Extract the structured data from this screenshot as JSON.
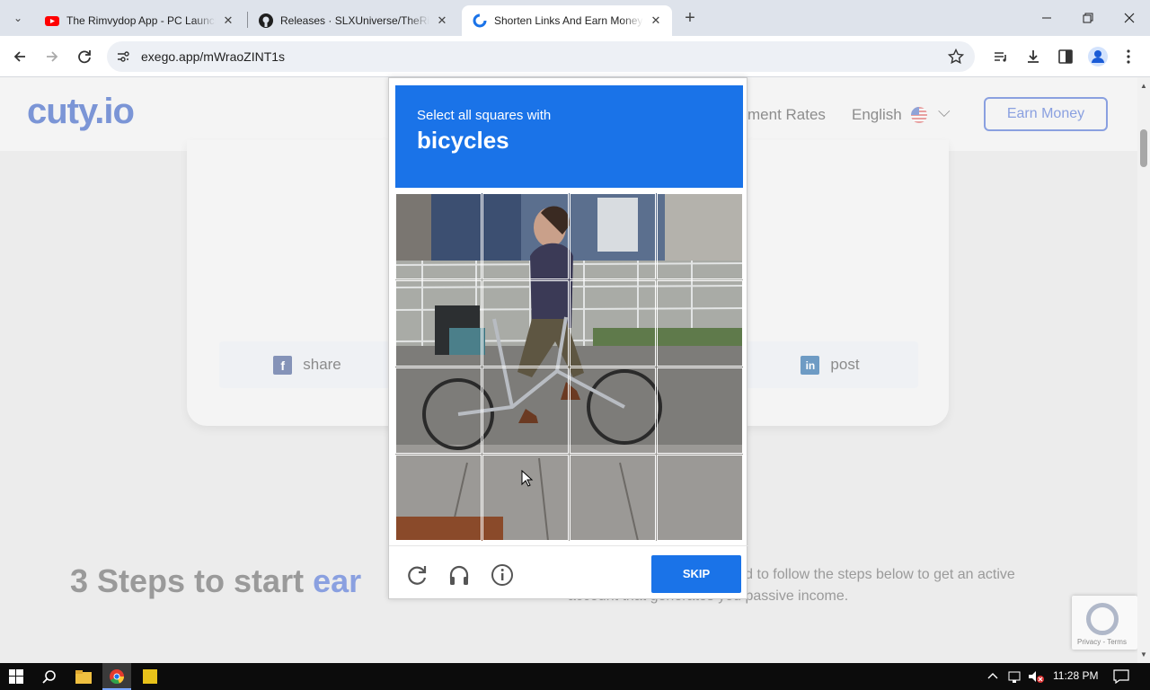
{
  "browser": {
    "tabs": [
      {
        "title": "The Rimvydop App - PC Launcher",
        "favicon": "youtube-icon",
        "active": false
      },
      {
        "title": "Releases · SLXUniverse/TheRimvydop",
        "favicon": "github-icon",
        "active": false
      },
      {
        "title": "Shorten Links And Earn Money | Cuty.io",
        "favicon": "cuty-icon",
        "active": true
      }
    ],
    "new_tab": "+",
    "url": "exego.app/mWraoZINT1s",
    "window_controls": [
      "minimize",
      "restore",
      "close"
    ]
  },
  "site": {
    "logo": "cuty.io",
    "nav_rates": "ment Rates",
    "language": "English",
    "earn_button": "Earn Money",
    "share_label": "share",
    "post_label": "post",
    "steps_title_a": "3 Steps to start ",
    "steps_title_b": "ear",
    "steps_desc": "o is very easy. You only need to follow the steps below to get an active account that generates you passive income.",
    "recaptcha_terms": "Privacy - Terms"
  },
  "captcha": {
    "instruction": "Select all squares with",
    "object": "bicycles",
    "skip_label": "SKIP",
    "grid": {
      "rows": 4,
      "cols": 4
    },
    "footer_icons": [
      "reload-icon",
      "audio-headphones-icon",
      "info-icon"
    ]
  },
  "taskbar": {
    "time": "11:28 PM"
  },
  "colors": {
    "captcha_blue": "#1a73e8",
    "brand": "#7b95d6",
    "tabstrip": "#dee3eb"
  }
}
